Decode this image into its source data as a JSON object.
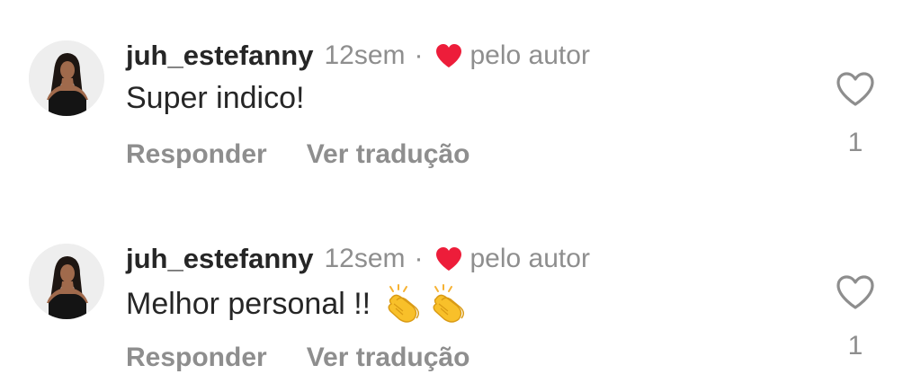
{
  "comments": [
    {
      "username": "juh_estefanny",
      "time": "12sem",
      "separator": "·",
      "liked_by_author_label": "pelo autor",
      "text": "Super indico!",
      "emoji": [],
      "actions": {
        "reply_label": "Responder",
        "translate_label": "Ver tradução"
      },
      "like_count": "1"
    },
    {
      "username": "juh_estefanny",
      "time": "12sem",
      "separator": "·",
      "liked_by_author_label": "pelo autor",
      "text": "Melhor personal !!",
      "emoji": [
        "clapping-hands",
        "clapping-hands"
      ],
      "actions": {
        "reply_label": "Responder",
        "translate_label": "Ver tradução"
      },
      "like_count": "1"
    }
  ],
  "colors": {
    "text_primary": "#262626",
    "text_secondary": "#8e8e8e",
    "author_heart": "#ed1d3a",
    "background": "#ffffff"
  },
  "icons": {
    "author_heart": "heart-filled-icon",
    "like": "heart-outline-icon",
    "emoji": "clapping-hands-emoji"
  }
}
